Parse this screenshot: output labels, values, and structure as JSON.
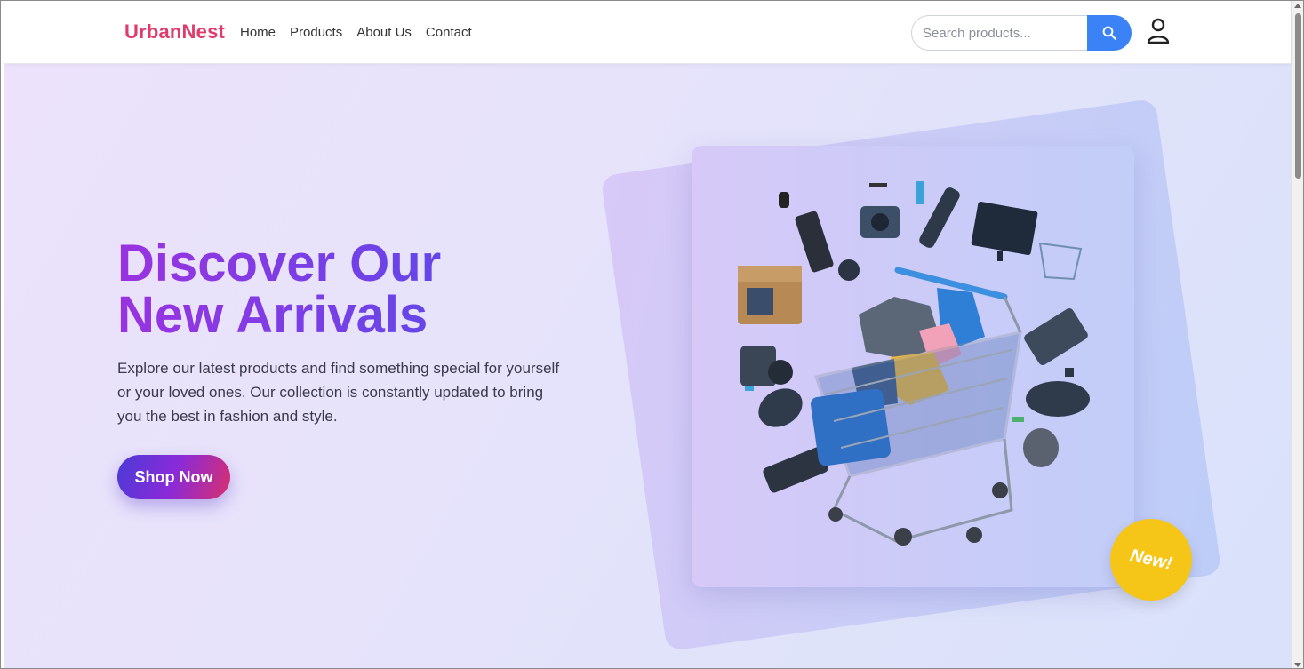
{
  "navbar": {
    "brand": "UrbanNest",
    "links": [
      {
        "label": "Home"
      },
      {
        "label": "Products"
      },
      {
        "label": "About Us"
      },
      {
        "label": "Contact"
      }
    ],
    "search": {
      "placeholder": "Search products...",
      "value": "",
      "button_icon": "search-icon"
    },
    "account_icon": "user-icon"
  },
  "hero": {
    "headline_line1": "Discover Our",
    "headline_line2": "New Arrivals",
    "subtext": "Explore our latest products and find something special for yourself or your loved ones. Our collection is constantly updated to bring you the best in fashion and style.",
    "cta_label": "Shop Now",
    "image_content": "shopping cart overflowing with electronics and clothing",
    "badge": "New!"
  },
  "colors": {
    "brand": "#e03b6b",
    "accent_blue": "#3b82f6",
    "headline_purple": "#7b3ee6",
    "badge_yellow": "#f5c518"
  }
}
